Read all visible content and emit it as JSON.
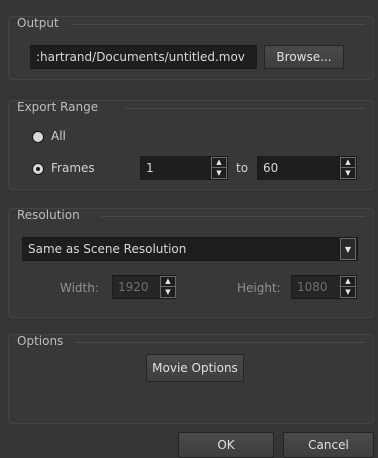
{
  "output": {
    "title": "Output",
    "path_value": ":hartrand/Documents/untitled.mov",
    "browse_label": "Browse..."
  },
  "export_range": {
    "title": "Export Range",
    "all_label": "All",
    "frames_label": "Frames",
    "selected": "Frames",
    "from_value": "1",
    "to_label": "to",
    "to_value": "60"
  },
  "resolution": {
    "title": "Resolution",
    "selected_option": "Same as Scene Resolution",
    "width_label": "Width:",
    "width_value": "1920",
    "height_label": "Height:",
    "height_value": "1080"
  },
  "options": {
    "title": "Options",
    "movie_options_label": "Movie Options"
  },
  "footer": {
    "ok_label": "OK",
    "cancel_label": "Cancel"
  }
}
